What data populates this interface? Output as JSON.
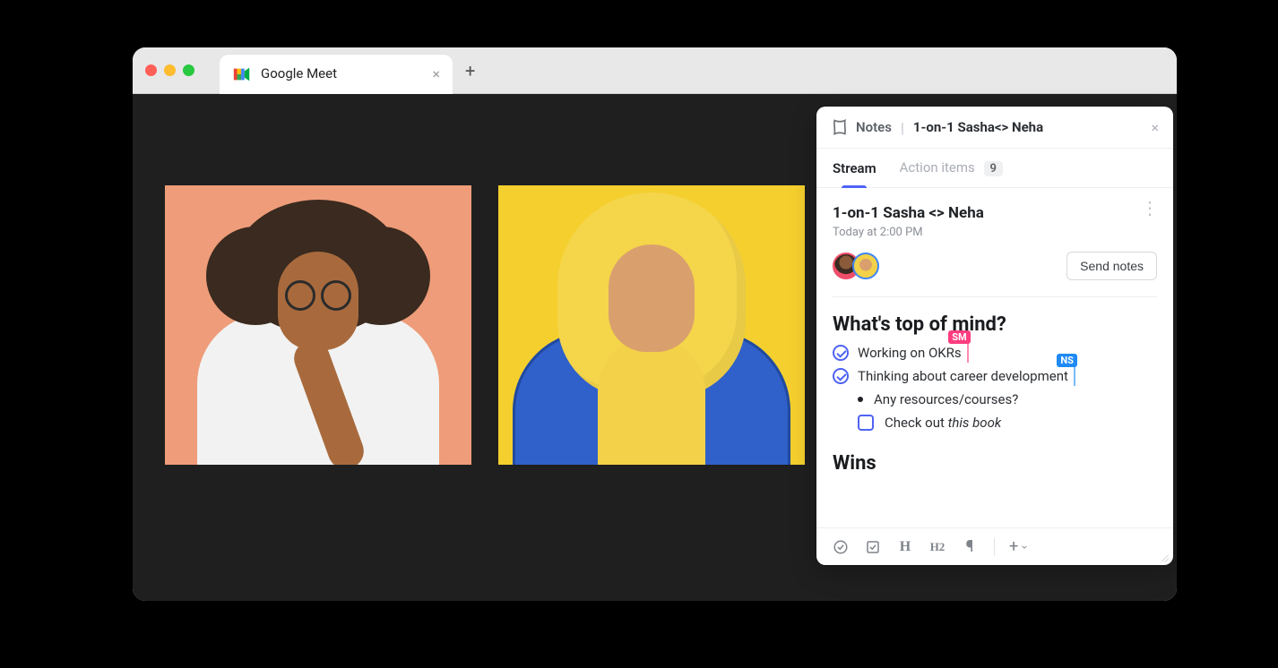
{
  "browser": {
    "tab_title": "Google Meet"
  },
  "panel": {
    "brand_label": "Notes",
    "meeting_name": "1-on-1 Sasha<> Neha",
    "tabs": {
      "stream": "Stream",
      "action_items": "Action items",
      "action_items_count": "9"
    },
    "stream": {
      "title": "1-on-1 Sasha <> Neha",
      "time": "Today at 2:00 PM",
      "send_button": "Send notes"
    },
    "notes": {
      "section1_heading": "What's top of mind?",
      "item1": "Working on OKRs",
      "item1_tag": "SM",
      "item2": "Thinking about career development",
      "item2_tag": "NS",
      "bullet1": "Any resources/courses?",
      "todo1_prefix": "Check out ",
      "todo1_italic": "this book",
      "section2_heading": "Wins"
    }
  }
}
